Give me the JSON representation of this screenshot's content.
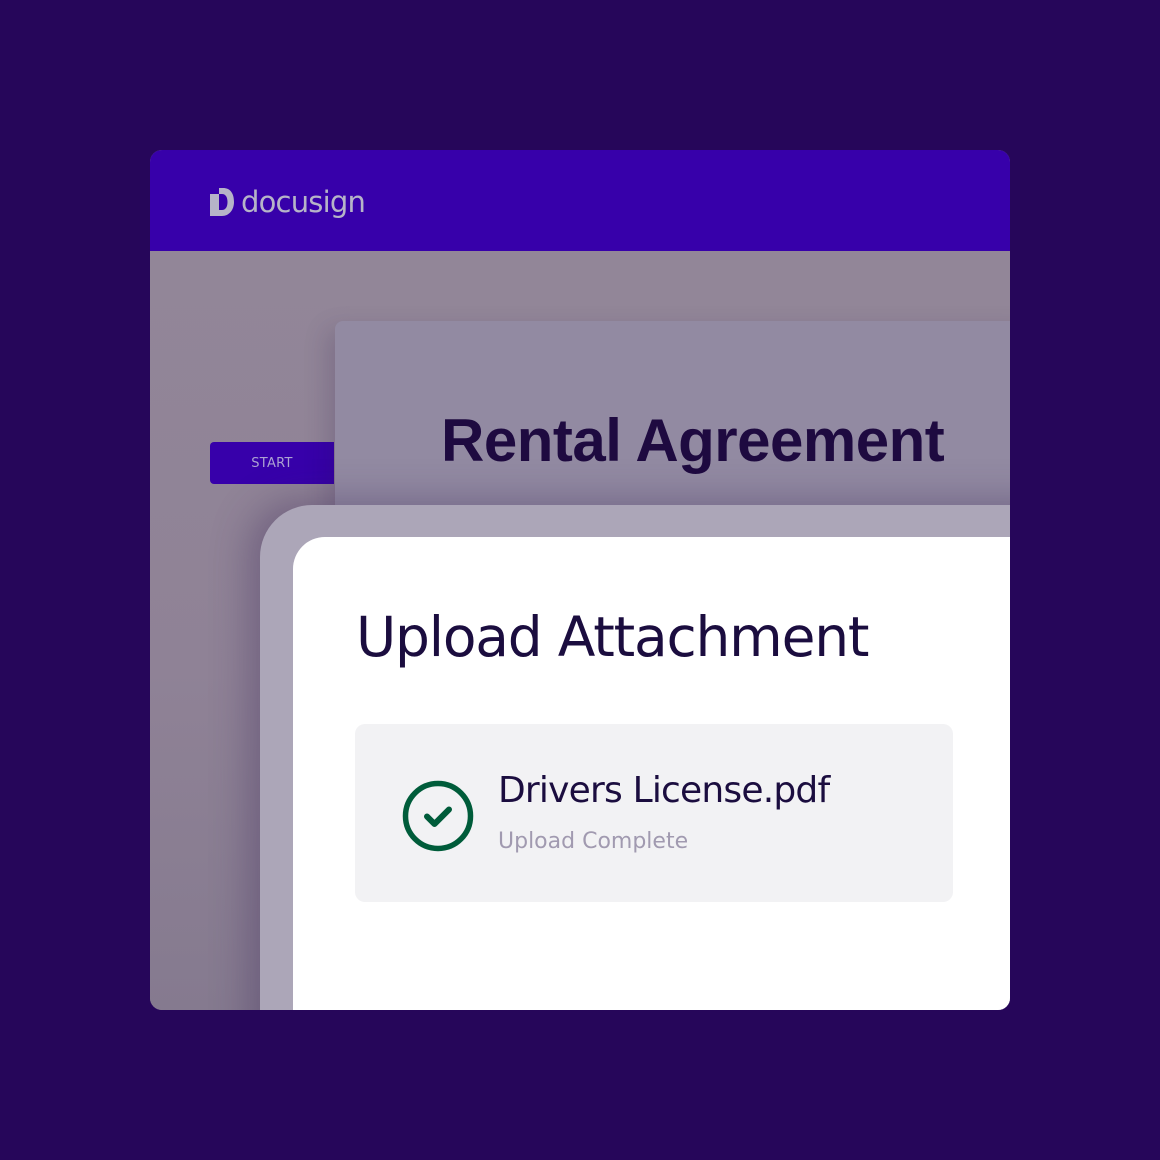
{
  "app": {
    "brand": "docusign",
    "brand_icon": "docusign-logo-icon",
    "colors": {
      "page_background": "#26065a",
      "header": "#3700aa",
      "accent_button": "#3700aa",
      "success": "#005c3a"
    }
  },
  "sidebar": {
    "start_button_label": "START"
  },
  "document": {
    "title": "Rental Agreement"
  },
  "modal": {
    "title": "Upload Attachment",
    "attachment": {
      "file_name": "Drivers License.pdf",
      "status": "Upload Complete",
      "status_icon": "check-circle-icon"
    }
  }
}
